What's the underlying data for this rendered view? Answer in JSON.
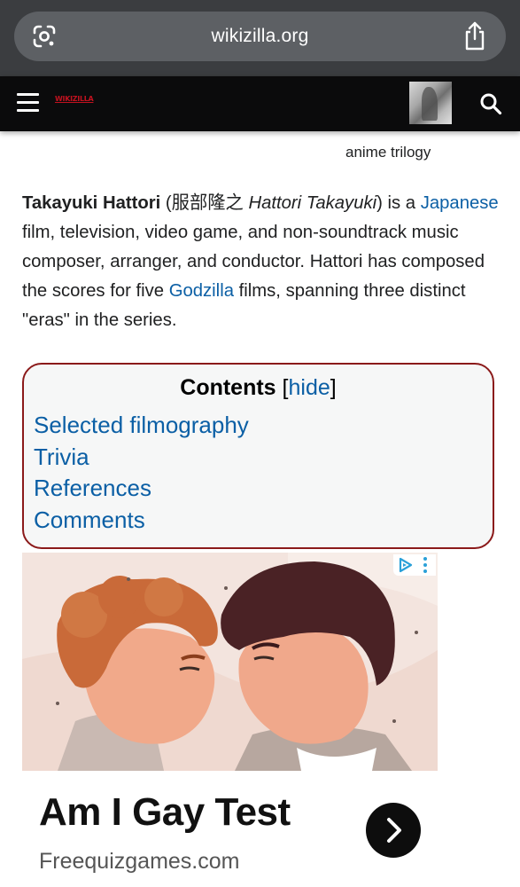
{
  "browser": {
    "url": "wikizilla.org"
  },
  "site": {
    "logo_text": "WIKIZILLA"
  },
  "article": {
    "image_caption": "anime trilogy",
    "intro": {
      "name": "Takayuki Hattori",
      "kanji_open": " (服部隆之 ",
      "romaji": "Hattori Takayuki",
      "after_romaji": ") is a ",
      "link_japanese": "Japanese",
      "middle": " film, television, video game, and non-soundtrack music composer, arranger, and conductor. Hattori has composed the scores for five ",
      "link_godzilla": "Godzilla",
      "end": " films, spanning three distinct \"eras\" in the series."
    },
    "toc": {
      "title": "Contents",
      "bracket_open": " [",
      "toggle": "hide",
      "bracket_close": "]",
      "items": [
        "Selected filmography",
        "Trivia",
        "References",
        "Comments"
      ]
    }
  },
  "ad": {
    "headline": "Am I Gay Test",
    "domain": "Freequizgames.com"
  },
  "colors": {
    "link": "#0b5fa5",
    "toc_border": "#8b1a1a",
    "browser_bg": "#3b3d40",
    "header_bg": "#0b0b0c"
  }
}
